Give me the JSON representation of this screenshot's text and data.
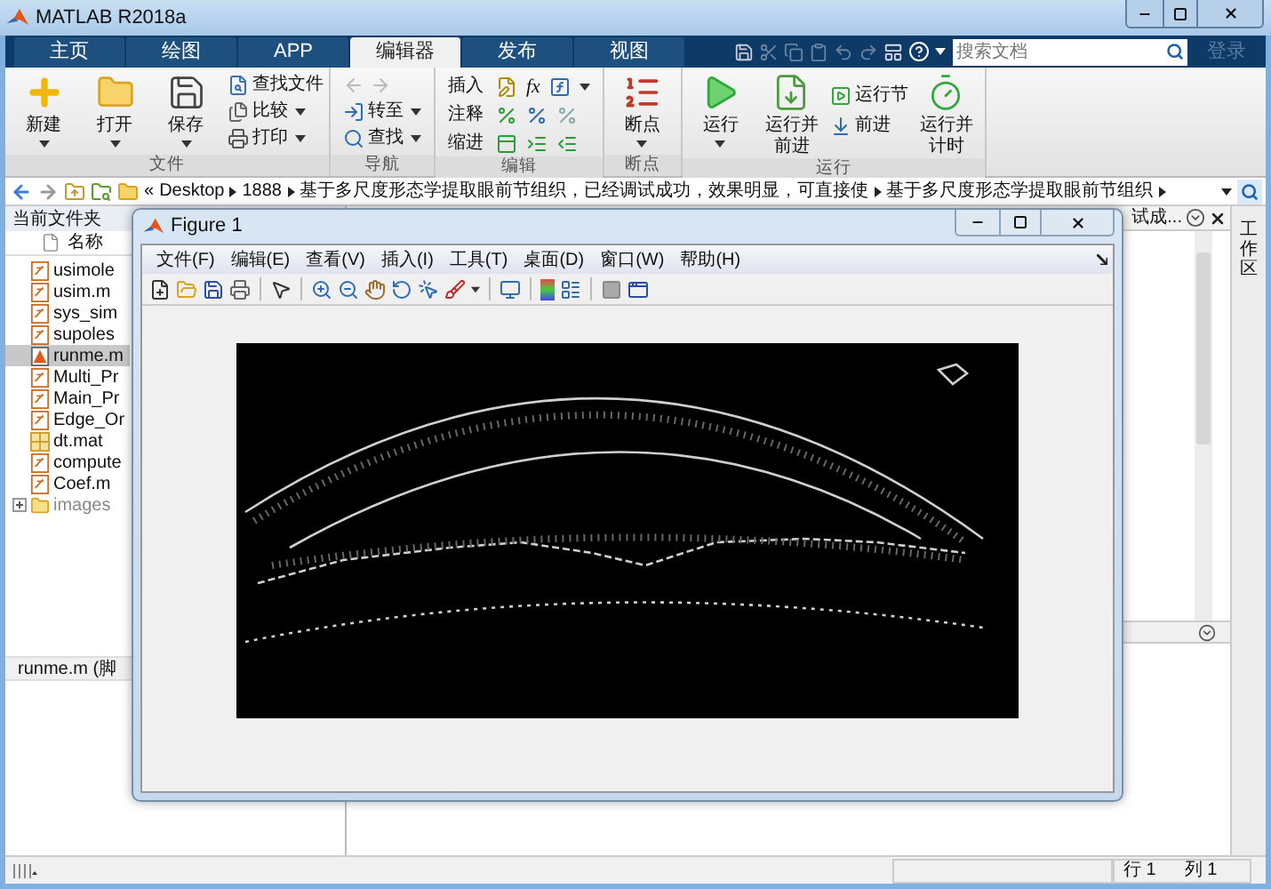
{
  "window": {
    "title": "MATLAB R2018a"
  },
  "tabs": [
    {
      "label": "主页",
      "selected": false
    },
    {
      "label": "绘图",
      "selected": false
    },
    {
      "label": "APP",
      "selected": false
    },
    {
      "label": "编辑器",
      "selected": true
    },
    {
      "label": "发布",
      "selected": false
    },
    {
      "label": "视图",
      "selected": false
    }
  ],
  "search": {
    "placeholder": "搜索文档"
  },
  "login": "登录",
  "ribbon": {
    "groups": [
      {
        "label": "文件",
        "kind": "file",
        "items": [
          {
            "label": "新建",
            "dropdown": true
          },
          {
            "label": "打开",
            "dropdown": true
          },
          {
            "label": "保存",
            "dropdown": true
          },
          {
            "label": "查找文件",
            "dropdown": false
          },
          {
            "label": "比较",
            "dropdown": true
          },
          {
            "label": "打印",
            "dropdown": true
          }
        ]
      },
      {
        "label": "导航",
        "kind": "navigate",
        "items": [
          {
            "label": "转至",
            "dropdown": true
          },
          {
            "label": "查找",
            "dropdown": true
          }
        ]
      },
      {
        "label": "编辑",
        "kind": "edit",
        "function_symbol": "fx",
        "items": [
          {
            "label": "插入"
          },
          {
            "label": "注释"
          },
          {
            "label": "缩进"
          }
        ]
      },
      {
        "label": "断点",
        "kind": "breakpoints",
        "items": [
          {
            "label": "断点",
            "dropdown": true
          }
        ]
      },
      {
        "label": "运行",
        "kind": "run",
        "items": [
          {
            "label": "运行",
            "dropdown": true
          },
          {
            "label": "运行并前进",
            "dropdown": false
          },
          {
            "label": "运行节",
            "dropdown": false
          },
          {
            "label": "前进",
            "dropdown": false
          },
          {
            "label": "运行并计时",
            "dropdown": false
          }
        ]
      }
    ]
  },
  "address_bar": {
    "prefix": "«",
    "path": [
      "Desktop",
      "1888",
      "基于多尺度形态学提取眼前节组织，已经调试成功，效果明显，可直接使",
      "基于多尺度形态学提取眼前节组织"
    ]
  },
  "current_folder": {
    "title": "当前文件夹",
    "column": "名称",
    "files": [
      {
        "name": "usimole",
        "kind": "m",
        "selected": false
      },
      {
        "name": "usim.m",
        "kind": "m",
        "selected": false
      },
      {
        "name": "sys_sim",
        "kind": "m",
        "selected": false
      },
      {
        "name": "supoles",
        "kind": "m",
        "selected": false
      },
      {
        "name": "runme.m",
        "kind": "script",
        "selected": true
      },
      {
        "name": "Multi_Pr",
        "kind": "m",
        "selected": false
      },
      {
        "name": "Main_Pr",
        "kind": "m",
        "selected": false
      },
      {
        "name": "Edge_Or",
        "kind": "m",
        "selected": false
      },
      {
        "name": "dt.mat",
        "kind": "mat",
        "selected": false
      },
      {
        "name": "compute",
        "kind": "m",
        "selected": false
      },
      {
        "name": "Coef.m",
        "kind": "m",
        "selected": false
      },
      {
        "name": "images",
        "kind": "folder",
        "selected": false
      }
    ],
    "details": "runme.m (脚"
  },
  "editor": {
    "tab_text": "试成..."
  },
  "workspace": {
    "label": "工作区"
  },
  "figure": {
    "title": "Figure 1",
    "menus": [
      "文件(F)",
      "编辑(E)",
      "查看(V)",
      "插入(I)",
      "工具(T)",
      "桌面(D)",
      "窗口(W)",
      "帮助(H)"
    ]
  },
  "status_bar": {
    "line": "行 1",
    "column": "列 1"
  }
}
